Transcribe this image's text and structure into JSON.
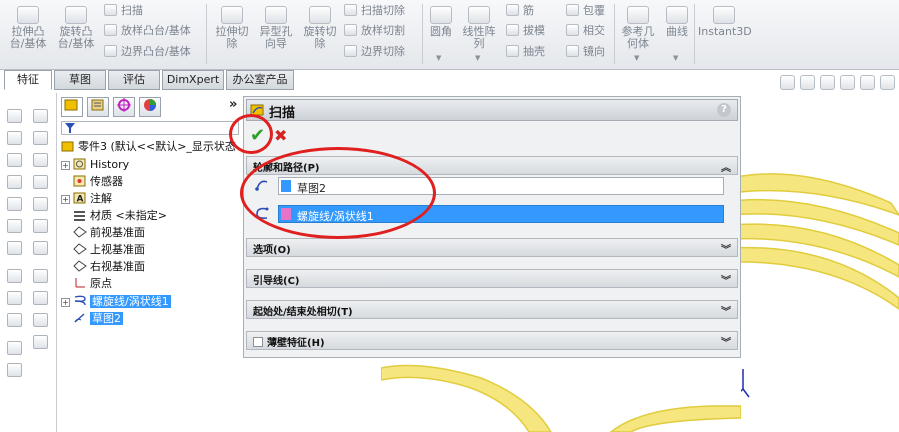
{
  "ribbon": {
    "extrude_boss": "拉伸凸\n台/基体",
    "revolve_boss": "旋转凸\n台/基体",
    "sweep": "扫描",
    "loft_boss": "放样凸台/基体",
    "boundary_boss": "边界凸台/基体",
    "extrude_cut": "拉伸切\n除",
    "hole_wizard": "异型孔\n向导",
    "revolve_cut": "旋转切\n除",
    "swept_cut": "扫描切除",
    "lofted_cut": "放样切割",
    "boundary_cut": "边界切除",
    "fillet": "圆角",
    "linear_pattern": "线性阵\n列",
    "rib": "筋",
    "draft": "拔模",
    "shell": "抽壳",
    "wrap": "包覆",
    "intersect": "相交",
    "mirror": "镜向",
    "ref_geometry": "参考几\n何体",
    "curves": "曲线",
    "instant3d": "Instant3D"
  },
  "tabs": [
    {
      "label": "特征"
    },
    {
      "label": "草图"
    },
    {
      "label": "评估"
    },
    {
      "label": "DimXpert"
    },
    {
      "label": "办公室产品"
    }
  ],
  "tree": {
    "root": "零件3 (默认<<默认>_显示状态",
    "items": [
      {
        "label": "History"
      },
      {
        "label": "传感器"
      },
      {
        "label": "注解"
      },
      {
        "label": "材质 <未指定>"
      },
      {
        "label": "前视基准面"
      },
      {
        "label": "上视基准面"
      },
      {
        "label": "右视基准面"
      },
      {
        "label": "原点"
      },
      {
        "label": "螺旋线/涡状线1"
      },
      {
        "label": "草图2"
      }
    ],
    "collapse_glyph": "»"
  },
  "property_manager": {
    "title": "扫描",
    "help": "?",
    "ok_glyph": "✔",
    "cancel_glyph": "✖",
    "groups": {
      "profile_path": {
        "label": "轮廓和路径(P)",
        "caret": "︽"
      },
      "options": {
        "label": "选项(O)",
        "caret": "︾"
      },
      "guide_curves": {
        "label": "引导线(C)",
        "caret": "︾"
      },
      "start_end": {
        "label": "起始处/结束处相切(T)",
        "caret": "︾"
      },
      "thin": {
        "label": "薄壁特征(H)",
        "caret": "︾"
      }
    },
    "profile_value": "草图2",
    "path_value": "螺旋线/涡状线1"
  },
  "colors": {
    "accent_selection": "#3399ff",
    "annotation_red": "#e01f1f",
    "preview_yellow": "#f5e680",
    "ok_green": "#2ba02b"
  }
}
